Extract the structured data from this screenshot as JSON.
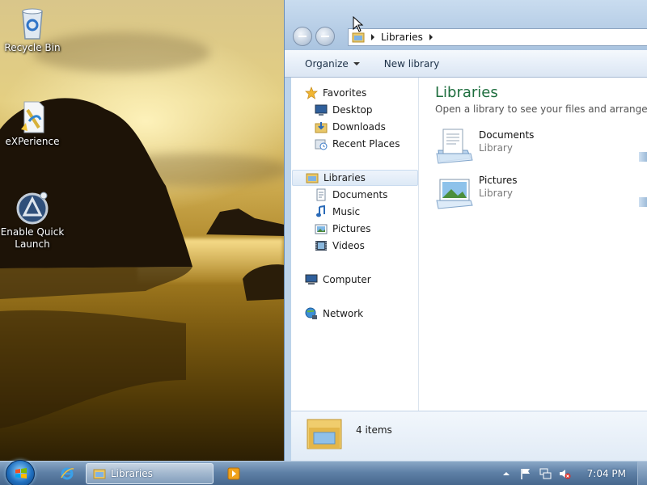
{
  "desktop": {
    "icons": [
      {
        "label": "Recycle Bin",
        "icon": "recycle-bin-icon"
      },
      {
        "label": "eXPerience",
        "icon": "document-icon"
      },
      {
        "label": "Enable Quick Launch",
        "icon": "quick-launch-icon"
      }
    ]
  },
  "explorer": {
    "breadcrumb": [
      "Libraries"
    ],
    "toolbar": {
      "organize_label": "Organize",
      "new_library_label": "New library"
    },
    "nav": {
      "favorites": "Favorites",
      "favorites_items": [
        "Desktop",
        "Downloads",
        "Recent Places"
      ],
      "libraries": "Libraries",
      "libraries_items": [
        "Documents",
        "Music",
        "Pictures",
        "Videos"
      ],
      "computer": "Computer",
      "network": "Network"
    },
    "content": {
      "heading": "Libraries",
      "subtitle": "Open a library to see your files and arrange them b",
      "libraries": [
        {
          "name": "Documents",
          "type": "Library"
        },
        {
          "name": "Pictures",
          "type": "Library"
        }
      ]
    },
    "details": {
      "item_count": "4 items"
    }
  },
  "taskbar": {
    "active_window": "Libraries",
    "clock": "7:04 PM"
  }
}
